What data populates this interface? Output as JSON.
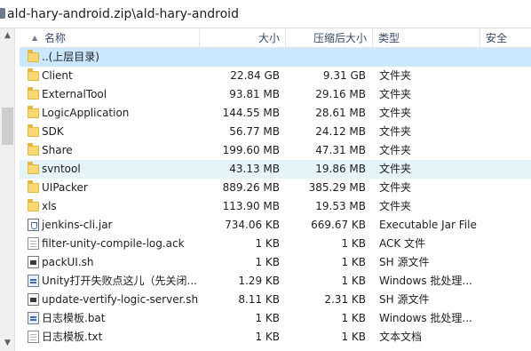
{
  "path": "ald-hary-android.zip\\ald-hary-android",
  "columns": {
    "name": "名称",
    "size": "大小",
    "compressed": "压缩后大小",
    "type": "类型",
    "security": "安全"
  },
  "rows": [
    {
      "name": "..(上层目录)",
      "size": "",
      "compressed": "",
      "type": "",
      "icon": "folder-icon"
    },
    {
      "name": "Client",
      "size": "22.84 GB",
      "compressed": "9.31 GB",
      "type": "文件夹",
      "icon": "folder-icon"
    },
    {
      "name": "ExternalTool",
      "size": "93.81 MB",
      "compressed": "29.16 MB",
      "type": "文件夹",
      "icon": "folder-icon"
    },
    {
      "name": "LogicApplication",
      "size": "144.55 MB",
      "compressed": "28.61 MB",
      "type": "文件夹",
      "icon": "folder-icon"
    },
    {
      "name": "SDK",
      "size": "56.77 MB",
      "compressed": "24.12 MB",
      "type": "文件夹",
      "icon": "folder-icon"
    },
    {
      "name": "Share",
      "size": "199.60 MB",
      "compressed": "47.31 MB",
      "type": "文件夹",
      "icon": "folder-icon"
    },
    {
      "name": "svntool",
      "size": "43.13 MB",
      "compressed": "19.86 MB",
      "type": "文件夹",
      "icon": "folder-icon"
    },
    {
      "name": "UIPacker",
      "size": "889.26 MB",
      "compressed": "385.29 MB",
      "type": "文件夹",
      "icon": "folder-icon"
    },
    {
      "name": "xls",
      "size": "113.90 MB",
      "compressed": "19.53 MB",
      "type": "文件夹",
      "icon": "folder-icon"
    },
    {
      "name": "jenkins-cli.jar",
      "size": "734.06 KB",
      "compressed": "669.67 KB",
      "type": "Executable Jar File",
      "icon": "jar-file-icon"
    },
    {
      "name": "filter-unity-compile-log.ack",
      "size": "1 KB",
      "compressed": "1 KB",
      "type": "ACK 文件",
      "icon": "file-icon"
    },
    {
      "name": "packUI.sh",
      "size": "1 KB",
      "compressed": "1 KB",
      "type": "SH 源文件",
      "icon": "shell-script-icon"
    },
    {
      "name": "Unity打开失败点这儿（先关闭...",
      "size": "1.29 KB",
      "compressed": "1 KB",
      "type": "Windows 批处理...",
      "icon": "batch-file-icon"
    },
    {
      "name": "update-vertify-logic-server.sh",
      "size": "8.11 KB",
      "compressed": "2.31 KB",
      "type": "SH 源文件",
      "icon": "shell-script-icon"
    },
    {
      "name": "日志模板.bat",
      "size": "1 KB",
      "compressed": "1 KB",
      "type": "Windows 批处理...",
      "icon": "batch-file-icon"
    },
    {
      "name": "日志模板.txt",
      "size": "1 KB",
      "compressed": "1 KB",
      "type": "文本文档",
      "icon": "file-icon"
    }
  ],
  "scrollbar": {
    "up": "▲",
    "down": "▼",
    "position": 0.25
  },
  "sort_indicator": "▲",
  "colors": {
    "selected_row": "#cce8ff",
    "hover_row": "#e5f3fb",
    "folder": "#f8d775",
    "header_text": "#3a4b66"
  }
}
